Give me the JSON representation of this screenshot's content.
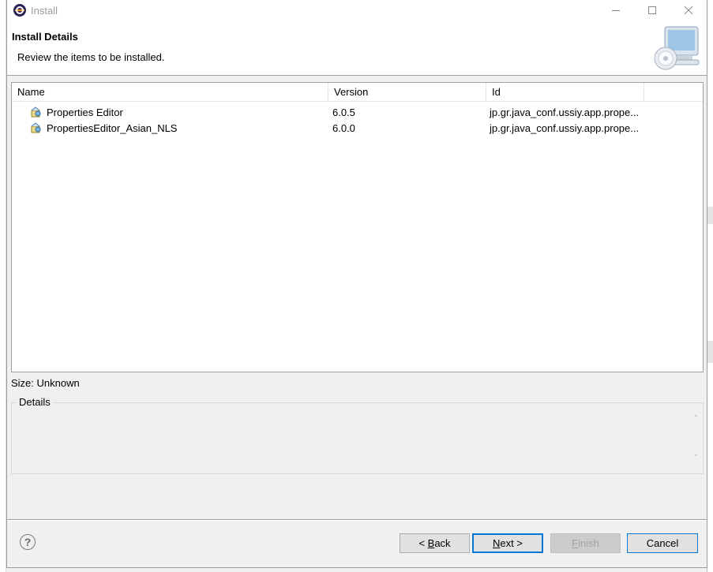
{
  "window": {
    "title": "Install"
  },
  "header": {
    "title": "Install Details",
    "description": "Review the items to be installed."
  },
  "table": {
    "columns": [
      "Name",
      "Version",
      "Id"
    ],
    "rows": [
      {
        "name": "Properties Editor",
        "version": "6.0.5",
        "id": "jp.gr.java_conf.ussiy.app.prope..."
      },
      {
        "name": "PropertiesEditor_Asian_NLS",
        "version": "6.0.0",
        "id": "jp.gr.java_conf.ussiy.app.prope..."
      }
    ]
  },
  "size": "Size: Unknown",
  "details": {
    "label": "Details"
  },
  "buttons": {
    "back_prefix": "< ",
    "back_key": "B",
    "back_rest": "ack",
    "next_key": "N",
    "next_rest": "ext >",
    "finish_key": "F",
    "finish_rest": "inish",
    "cancel": "Cancel"
  },
  "icons": {
    "app": "eclipse-icon",
    "help": "help-icon",
    "feature": "feature-plugin-icon",
    "banner": "install-computer-cd-icon"
  }
}
